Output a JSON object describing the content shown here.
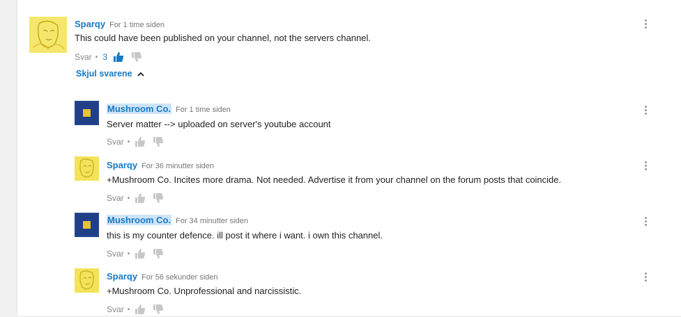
{
  "colors": {
    "link": "#167ac6",
    "muted": "#767676",
    "text": "#222222",
    "highlight": "#cfe3f7"
  },
  "top_comment": {
    "author": "Sparqy",
    "time": "For 1 time siden",
    "text": "This could have been published on your channel, not the servers channel.",
    "reply_label": "Svar",
    "likes": "3",
    "avatar": "yellow-sketch-avatar"
  },
  "toggle_replies": {
    "label": "Skjul svarene",
    "icon": "chevron-up-icon"
  },
  "replies": [
    {
      "author": "Mushroom Co.",
      "time": "For 1 time siden",
      "text": "Server matter --> uploaded on server's youtube account",
      "reply_label": "Svar",
      "avatar": "blue-square-avatar"
    },
    {
      "author": "Sparqy",
      "time": "For 36 minutter siden",
      "text": "+Mushroom Co. Incites more drama. Not needed. Advertise it from your channel on the forum posts that coincide.",
      "reply_label": "Svar",
      "avatar": "yellow-sketch-avatar"
    },
    {
      "author": "Mushroom Co.",
      "time": "For 34 minutter siden",
      "text": "this is my counter defence. ill post it where i want. i own this channel.",
      "reply_label": "Svar",
      "avatar": "blue-square-avatar"
    },
    {
      "author": "Sparqy",
      "time": "For 56 sekunder siden",
      "text": "+Mushroom Co. Unprofessional and narcissistic.",
      "reply_label": "Svar",
      "avatar": "yellow-sketch-avatar"
    }
  ]
}
